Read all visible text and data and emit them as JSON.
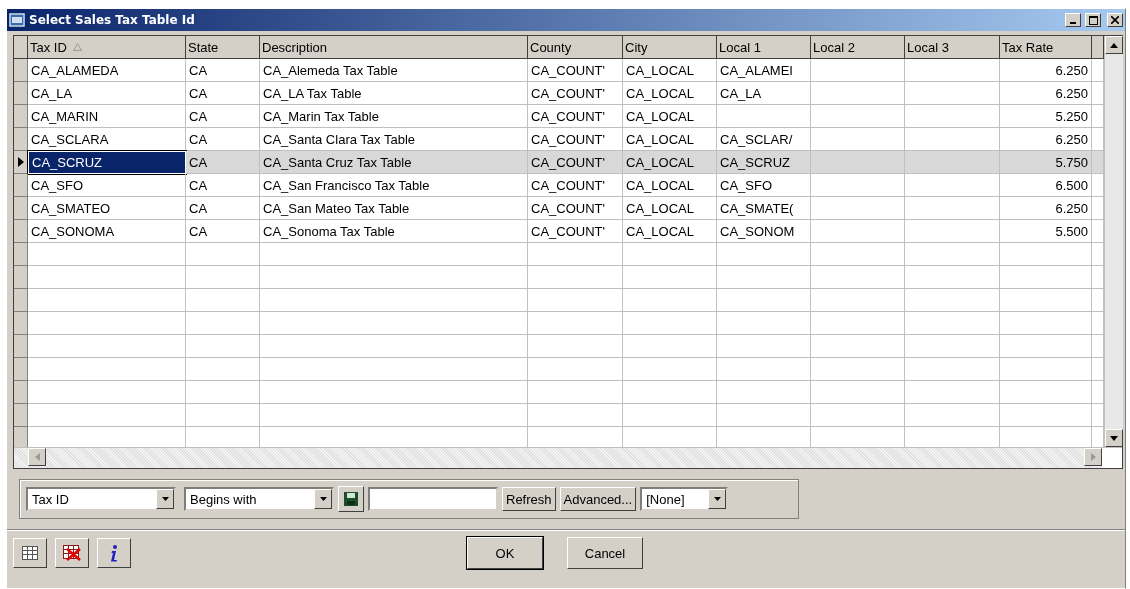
{
  "window": {
    "title": "Select Sales Tax Table Id"
  },
  "table": {
    "columns": [
      {
        "label": "Tax ID",
        "sorted": true
      },
      {
        "label": "State",
        "sorted": false
      },
      {
        "label": "Description",
        "sorted": false
      },
      {
        "label": "County",
        "sorted": false
      },
      {
        "label": "City",
        "sorted": false
      },
      {
        "label": "Local 1",
        "sorted": false
      },
      {
        "label": "Local 2",
        "sorted": false
      },
      {
        "label": "Local 3",
        "sorted": false
      },
      {
        "label": "Tax Rate",
        "sorted": false
      }
    ],
    "rows": [
      {
        "selected": false,
        "cells": [
          "CA_ALAMEDA",
          "CA",
          "CA_Alemeda Tax Table",
          "CA_COUNT'",
          "CA_LOCAL",
          "CA_ALAMEI",
          "",
          "",
          "6.250"
        ]
      },
      {
        "selected": false,
        "cells": [
          "CA_LA",
          "CA",
          "CA_LA Tax Table",
          "CA_COUNT'",
          "CA_LOCAL",
          "CA_LA",
          "",
          "",
          "6.250"
        ]
      },
      {
        "selected": false,
        "cells": [
          "CA_MARIN",
          "CA",
          "CA_Marin Tax Table",
          "CA_COUNT'",
          "CA_LOCAL",
          "",
          "",
          "",
          "5.250"
        ]
      },
      {
        "selected": false,
        "cells": [
          "CA_SCLARA",
          "CA",
          "CA_Santa Clara Tax Table",
          "CA_COUNT'",
          "CA_LOCAL",
          "CA_SCLAR/",
          "",
          "",
          "6.250"
        ]
      },
      {
        "selected": true,
        "cells": [
          "CA_SCRUZ",
          "CA",
          "CA_Santa Cruz Tax Table",
          "CA_COUNT'",
          "CA_LOCAL",
          "CA_SCRUZ",
          "",
          "",
          "5.750"
        ]
      },
      {
        "selected": false,
        "cells": [
          "CA_SFO",
          "CA",
          "CA_San Francisco Tax Table",
          "CA_COUNT'",
          "CA_LOCAL",
          "CA_SFO",
          "",
          "",
          "6.500"
        ]
      },
      {
        "selected": false,
        "cells": [
          "CA_SMATEO",
          "CA",
          "CA_San Mateo Tax Table",
          "CA_COUNT'",
          "CA_LOCAL",
          "CA_SMATE(",
          "",
          "",
          "6.250"
        ]
      },
      {
        "selected": false,
        "cells": [
          "CA_SONOMA",
          "CA",
          "CA_Sonoma Tax Table",
          "CA_COUNT'",
          "CA_LOCAL",
          "CA_SONOM",
          "",
          "",
          "5.500"
        ]
      }
    ]
  },
  "filter": {
    "field": "Tax ID",
    "operator": "Begins with",
    "refresh": "Refresh",
    "advanced": "Advanced...",
    "preset": "[None]"
  },
  "buttons": [
    "OK",
    "Cancel"
  ]
}
